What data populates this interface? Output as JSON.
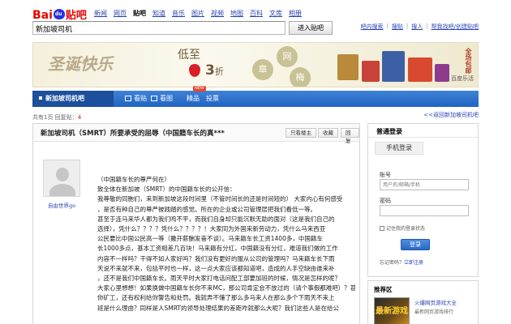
{
  "logo": {
    "bai": "Bai",
    "du": "du",
    "tieba": "贴吧"
  },
  "topnav": [
    "新闻",
    "网页",
    "贴吧",
    "知道",
    "音乐",
    "图片",
    "视频",
    "地图",
    "百科",
    "文库",
    "相册"
  ],
  "topnav_current": "贴吧",
  "search": {
    "value": "新加坡司机",
    "button": "进入贴吧"
  },
  "toplinks": [
    "吧内搜索",
    "|",
    "搜贴",
    "|",
    "搜人",
    "|",
    "帮我找吧/创建贴吧"
  ],
  "banner": {
    "script_text": "圣诞快乐",
    "low_price": "低至",
    "price": "3",
    "price_unit": "折",
    "circles": [
      "章",
      "网",
      "梅"
    ],
    "side_text": "全场包邮",
    "brand": "百度乐活"
  },
  "navbar": {
    "forum_title": "新加坡司机吧",
    "tabs": [
      "看贴",
      "看图",
      "精品",
      "投票"
    ],
    "new_badge": "NEW"
  },
  "back_link": "<<返回新加坡司机吧",
  "page_info": {
    "prefix": "共有1页  回复贴：",
    "count": "4"
  },
  "post": {
    "title": "新加坡司机（SMRT）所要承受的屈辱（中国籍车长的真***",
    "buttons": [
      "只看楼主",
      "收藏",
      "回复"
    ],
    "author": "自由世界go",
    "lines": [
      "（中国籍车长的尊严何在）",
      "致全体在新加坡（SMRT）的中国籍车长的公开信：",
      "我尊敬的同胞们，来到新加坡这段时间里（不管时间长的还是时间短的）  大家内心有何感受",
      "，是否有种自己的尊严被践踏的感觉。所在的企业或公司管理层把我们看低一等。",
      "甚至于连马来华人都为我们鸣不平，而我们自身却只能沉默无助的面对（这是我们自己的",
      "选择），凭什么？？？？凭什么？？？？！大家同为外国来新劳动力，凭什么马来西亚",
      "公民要比中国公民高一等（撇开薪酬发奋不谈）。马来籍车长工资1400多，中国籍车",
      "长1000多点，基本工资相差几百块！马来籍有分红，中国籍没有分红，难道我们做的工作",
      "内容不一样吗？干得不如人家好吗？我们没有更好的服从公司的管理吗？马来籍车长下雨",
      "天说不来就不来，包括平时也一样，这一点大家应该都知道吧，造成的人手空缺由谁来补",
      "，还不是我们中国籍车长。雨天平时大家打电话问配工部要加班的时候，情况是怎样的呢？",
      "大家心里想想！如果换做中国籍车长你不来MC，那公司肯定会不放过的（请个事假都难吧）？甚",
      "你矿工，还有权利给你警告和处罚。我就弄不懂了那么多马来人在那么多个下雨天不来上",
      "班是什么理由？同样是人SMRT的领导处理结果的差距咋就那么大呢？我们这些人是在给公"
    ]
  },
  "login": {
    "tab_common": "普通登录",
    "tab_phone": "手机登录",
    "account_label": "账号",
    "account_placeholder": "用户名/邮箱/手机",
    "password_label": "密码",
    "remember": "记住我的登录状态",
    "button": "登录",
    "forgot_prefix": "忘记密码？",
    "forgot_link": "立即注册"
  },
  "recommend": {
    "title": "推荐区",
    "thumb_text": "最新游戏",
    "game_title": "火爆网页游戏大全",
    "game_sub": "最新网页游戏排行"
  },
  "colors": {
    "brand_red": "#e10602",
    "nav_blue": "#2064c4",
    "link_blue": "#2a44b5"
  }
}
